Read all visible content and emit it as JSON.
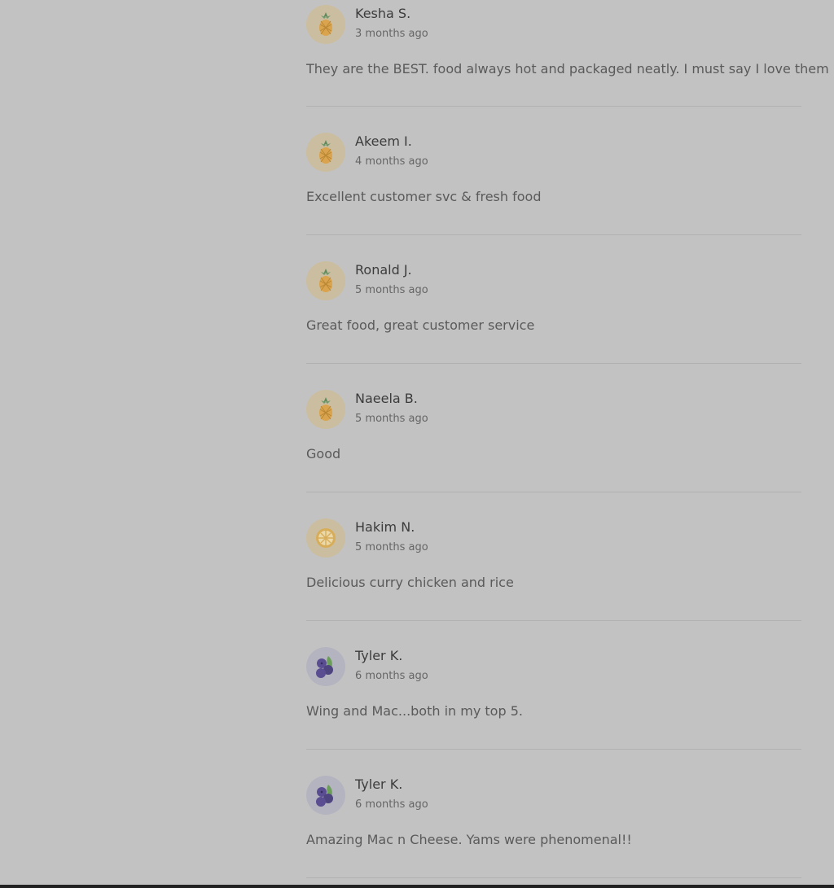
{
  "reviews": [
    {
      "name": "Kesha S.",
      "time": "3 months ago",
      "text": "They are the BEST. food always hot and packaged neatly. I must say I love them",
      "avatar": "pineapple-icon"
    },
    {
      "name": "Akeem I.",
      "time": "4 months ago",
      "text": "Excellent customer svc & fresh food",
      "avatar": "pineapple-icon"
    },
    {
      "name": "Ronald J.",
      "time": "5 months ago",
      "text": "Great food, great customer service",
      "avatar": "pineapple-icon"
    },
    {
      "name": "Naeela B.",
      "time": "5 months ago",
      "text": "Good",
      "avatar": "pineapple-icon"
    },
    {
      "name": "Hakim N.",
      "time": "5 months ago",
      "text": "Delicious curry chicken and rice",
      "avatar": "lemon-icon"
    },
    {
      "name": "Tyler K.",
      "time": "6 months ago",
      "text": "Wing and Mac...both in my top 5.",
      "avatar": "blueberry-icon"
    },
    {
      "name": "Tyler K.",
      "time": "6 months ago",
      "text": "Amazing Mac n Cheese. Yams were phenomenal!!",
      "avatar": "blueberry-icon"
    }
  ],
  "colors": {
    "overlay_background": "#c2c2c2",
    "pineapple_avatar_bg": "#cbbd9f",
    "berry_avatar_bg": "#b4b4c0"
  }
}
